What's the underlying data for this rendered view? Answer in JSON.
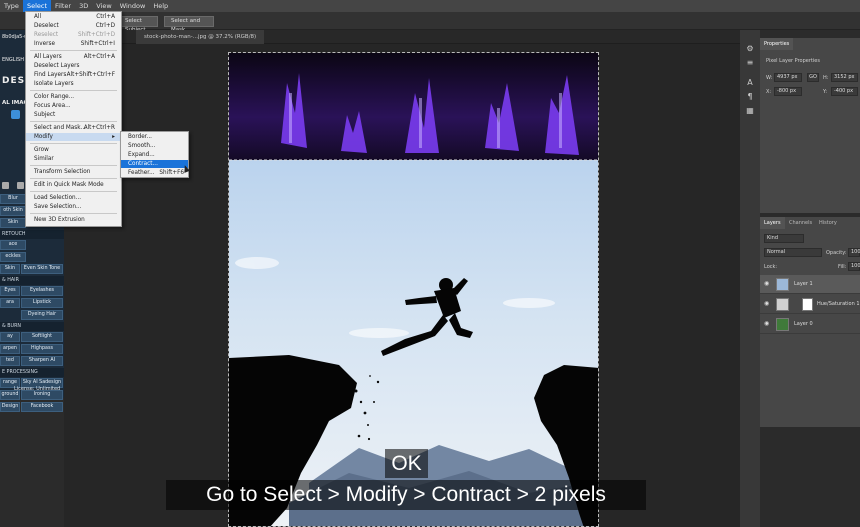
{
  "menubar": {
    "items": [
      "Type",
      "Select",
      "Filter",
      "3D",
      "View",
      "Window",
      "Help"
    ],
    "active": "Select"
  },
  "options_bar": {
    "select_subject_label": "Select Subject",
    "select_and_mask_label": "Select and Mask..."
  },
  "document_tab": {
    "title": "stock-photo-man-...jpg @ 37.2% (RGB/8)",
    "partial_id": "8b0dja5-u"
  },
  "select_menu": {
    "items": [
      {
        "label": "All",
        "shortcut": "Ctrl+A"
      },
      {
        "label": "Deselect",
        "shortcut": "Ctrl+D"
      },
      {
        "label": "Reselect",
        "shortcut": "Shift+Ctrl+D"
      },
      {
        "label": "Inverse",
        "shortcut": "Shift+Ctrl+I"
      },
      {
        "label": "All Layers",
        "shortcut": "Alt+Ctrl+A"
      },
      {
        "label": "Deselect Layers",
        "shortcut": ""
      },
      {
        "label": "Find Layers",
        "shortcut": "Alt+Shift+Ctrl+F"
      },
      {
        "label": "Isolate Layers",
        "shortcut": ""
      },
      {
        "label": "Color Range...",
        "shortcut": ""
      },
      {
        "label": "Focus Area...",
        "shortcut": ""
      },
      {
        "label": "Subject",
        "shortcut": ""
      },
      {
        "label": "Select and Mask...",
        "shortcut": "Alt+Ctrl+R"
      },
      {
        "label": "Modify",
        "shortcut": "▸"
      },
      {
        "label": "Grow",
        "shortcut": ""
      },
      {
        "label": "Similar",
        "shortcut": ""
      },
      {
        "label": "Transform Selection",
        "shortcut": ""
      },
      {
        "label": "Edit in Quick Mask Mode",
        "shortcut": ""
      },
      {
        "label": "Load Selection...",
        "shortcut": ""
      },
      {
        "label": "Save Selection...",
        "shortcut": ""
      },
      {
        "label": "New 3D Extrusion",
        "shortcut": ""
      }
    ]
  },
  "modify_submenu": {
    "items": [
      {
        "label": "Border...",
        "shortcut": ""
      },
      {
        "label": "Smooth...",
        "shortcut": ""
      },
      {
        "label": "Expand...",
        "shortcut": ""
      },
      {
        "label": "Contract...",
        "shortcut": ""
      },
      {
        "label": "Feather...",
        "shortcut": "Shift+F6"
      }
    ],
    "highlighted": "Contract..."
  },
  "left_panel": {
    "lang": "ENGLISH",
    "brand": "DESIG",
    "brand_sub": "AL IMAGE",
    "buttons": [
      "Blur",
      "oth Skin",
      "Skin",
      "RETOUCH",
      "ace",
      "eckles",
      "Skin",
      "Even Skin Tone",
      "& HAIR",
      "Eyes",
      "Eyelashes",
      "ara",
      "Lipstick",
      "Dyeing Hair",
      "& BURN",
      "ay",
      "Softlight",
      "arpen",
      "Highpass",
      "ted",
      "Sharpen AI",
      "E PROCESSING",
      "range",
      "Sky AI Sadesign",
      "ground",
      "Ironing",
      "Design",
      "Facebook",
      "License: Unlimited"
    ]
  },
  "properties": {
    "tab": "Properties",
    "section": "Pixel Layer Properties",
    "w_label": "W:",
    "w_value": "4937 px",
    "go_label": "GO",
    "h_label": "H:",
    "h_value": "3152 px",
    "x_label": "X:",
    "x_value": "-800 px",
    "y_label": "Y:",
    "y_value": "-400 px"
  },
  "layers": {
    "tabs": [
      "Layers",
      "Channels",
      "History"
    ],
    "kind_label": "Kind",
    "blend_mode": "Normal",
    "opacity_label": "Opacity:",
    "opacity_value": "100",
    "lock_label": "Lock:",
    "fill_label": "Fill:",
    "fill_value": "100",
    "items": [
      {
        "name": "Layer 1"
      },
      {
        "name": "Hue/Saturation 1"
      },
      {
        "name": "Layer 0"
      }
    ]
  },
  "captions": {
    "ok": "OK",
    "main": "Go to Select > Modify > Contract > 2 pixels"
  },
  "colors": {
    "menu_highlight": "#1a73d9",
    "panel_bg": "#474747",
    "left_panel_bg": "#1c2b3a",
    "sky_top": "#b7d3ef",
    "purple_glow": "#6a2bd8"
  }
}
